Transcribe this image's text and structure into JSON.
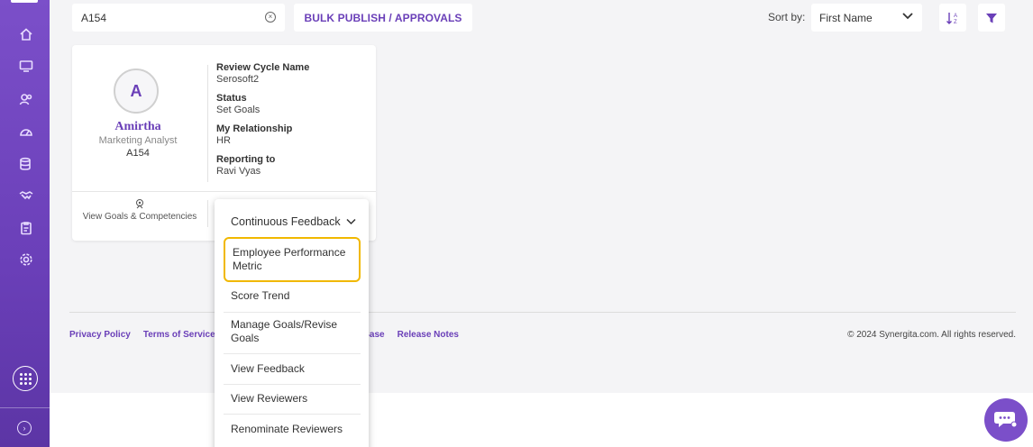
{
  "search": {
    "value": "A154"
  },
  "toolbar": {
    "bulk_label": "BULK PUBLISH / APPROVALS",
    "sort_label": "Sort by:",
    "sort_value": "First Name"
  },
  "card": {
    "avatar_letter": "A",
    "name": "Amirtha",
    "role": "Marketing Analyst",
    "id": "A154",
    "fields": [
      {
        "label": "Review Cycle Name",
        "value": "Serosoft2"
      },
      {
        "label": "Status",
        "value": "Set Goals"
      },
      {
        "label": "My Relationship",
        "value": "HR"
      },
      {
        "label": "Reporting to",
        "value": "Ravi Vyas"
      }
    ],
    "goals_link": "View Goals & Competencies"
  },
  "dropdown": {
    "header": "Continuous Feedback",
    "items": [
      "Employee Performance Metric",
      "Score Trend",
      "Manage Goals/Revise Goals",
      "View Feedback",
      "View Reviewers",
      "Renominate Reviewers"
    ]
  },
  "footer": {
    "links": [
      "Privacy Policy",
      "Terms of Service",
      "Base",
      "Release Notes"
    ],
    "copyright": "© 2024 Synergita.com. All rights reserved."
  },
  "colors": {
    "brand": "#6a3fb8",
    "highlight": "#f1b800"
  }
}
